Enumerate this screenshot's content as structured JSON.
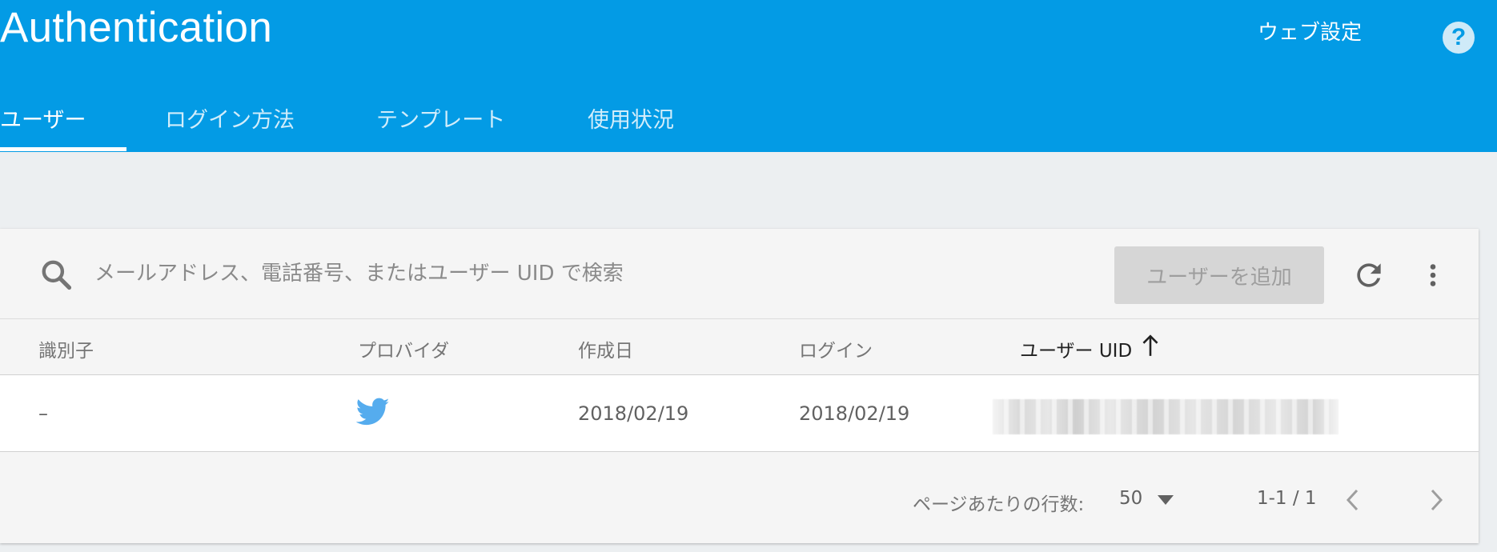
{
  "header": {
    "title": "Authentication",
    "web_settings_label": "ウェブ設定",
    "help_glyph": "?",
    "help_icon": "help-circle-icon"
  },
  "tabs": [
    {
      "label": "ユーザー",
      "active": true
    },
    {
      "label": "ログイン方法",
      "active": false
    },
    {
      "label": "テンプレート",
      "active": false
    },
    {
      "label": "使用状況",
      "active": false
    }
  ],
  "search": {
    "placeholder": "メールアドレス、電話番号、またはユーザー UID で検索",
    "value": "",
    "icon": "search-icon"
  },
  "toolbar": {
    "add_user_label": "ユーザーを追加",
    "add_user_enabled": false,
    "refresh_icon": "refresh-icon",
    "more_icon": "more-vert-icon"
  },
  "table": {
    "columns": [
      "識別子",
      "プロバイダ",
      "作成日",
      "ログイン",
      "ユーザー UID"
    ],
    "sorted_column": "ユーザー UID",
    "sort_direction": "ascending",
    "rows": [
      {
        "identifier": "–",
        "provider_icon": "twitter-icon",
        "created": "2018/02/19",
        "signed_in": "2018/02/19",
        "uid_redacted": true
      }
    ]
  },
  "pagination": {
    "rows_per_page_label": "ページあたりの行数:",
    "rows_per_page": "50",
    "range": "1-1 / 1"
  },
  "colors": {
    "header_bg": "#039be5",
    "page_bg": "#eceff1",
    "card_bg": "#f5f5f5",
    "twitter_blue": "#55acee"
  }
}
